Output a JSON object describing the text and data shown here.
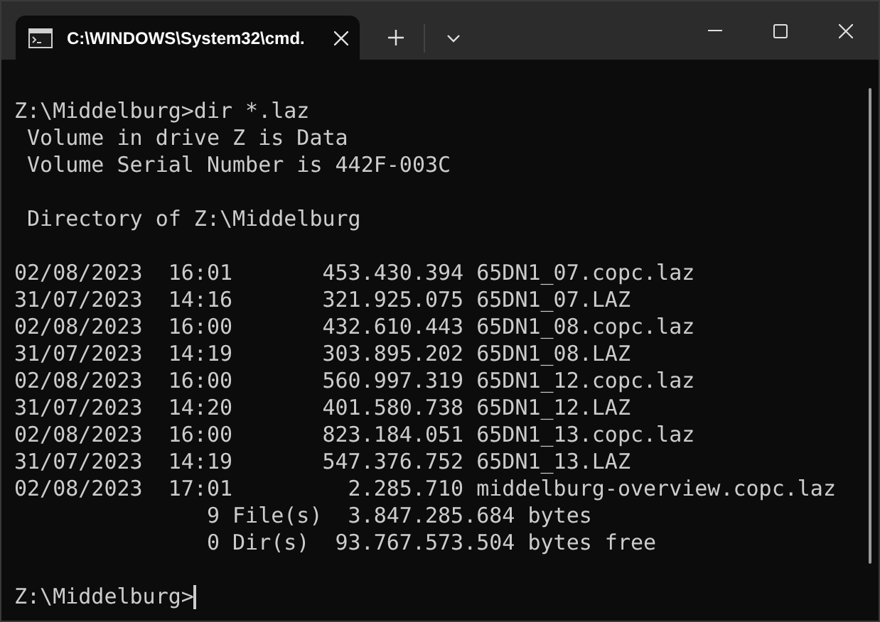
{
  "tab": {
    "title": "C:\\WINDOWS\\System32\\cmd.",
    "selected": true
  },
  "terminal": {
    "blocks": [
      [
        "Z:\\Middelburg>dir *.laz",
        " Volume in drive Z is Data",
        " Volume Serial Number is 442F-003C"
      ],
      [
        " Directory of Z:\\Middelburg"
      ],
      [
        "02/08/2023  16:01       453.430.394 65DN1_07.copc.laz",
        "31/07/2023  14:16       321.925.075 65DN1_07.LAZ",
        "02/08/2023  16:00       432.610.443 65DN1_08.copc.laz",
        "31/07/2023  14:19       303.895.202 65DN1_08.LAZ",
        "02/08/2023  16:00       560.997.319 65DN1_12.copc.laz",
        "31/07/2023  14:20       401.580.738 65DN1_12.LAZ",
        "02/08/2023  16:00       823.184.051 65DN1_13.copc.laz",
        "31/07/2023  14:19       547.376.752 65DN1_13.LAZ",
        "02/08/2023  17:01         2.285.710 middelburg-overview.copc.laz",
        "               9 File(s)  3.847.285.684 bytes",
        "               0 Dir(s)  93.767.573.504 bytes free"
      ],
      [
        "Z:\\Middelburg>"
      ]
    ],
    "cursor": true
  }
}
